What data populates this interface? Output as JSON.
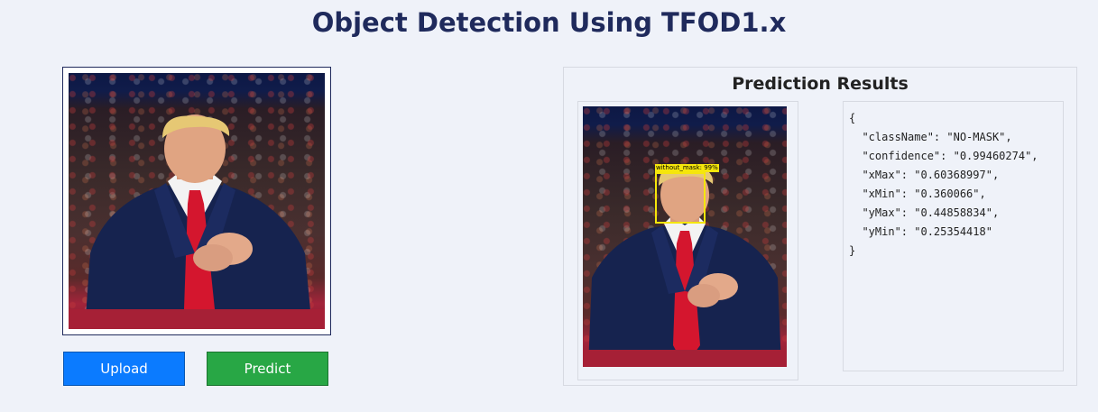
{
  "page": {
    "title": "Object Detection Using TFOD1.x"
  },
  "input_image": {
    "alt": "Input image: man in navy suit with red tie clapping in front of a crowd"
  },
  "buttons": {
    "upload_label": "Upload",
    "predict_label": "Predict"
  },
  "results": {
    "title": "Prediction Results",
    "detection_label": "without_mask: 99%",
    "json_lines": [
      "{",
      "  \"className\": \"NO-MASK\",",
      "  \"confidence\": \"0.99460274\",",
      "  \"xMax\": \"0.60368997\",",
      "  \"xMin\": \"0.360066\",",
      "  \"yMax\": \"0.44858834\",",
      "  \"yMin\": \"0.25354418\"",
      "}"
    ]
  },
  "colors": {
    "title": "#1f2a5c",
    "upload": "#0b7bff",
    "predict": "#28a745",
    "detection": "#f5e60b"
  }
}
